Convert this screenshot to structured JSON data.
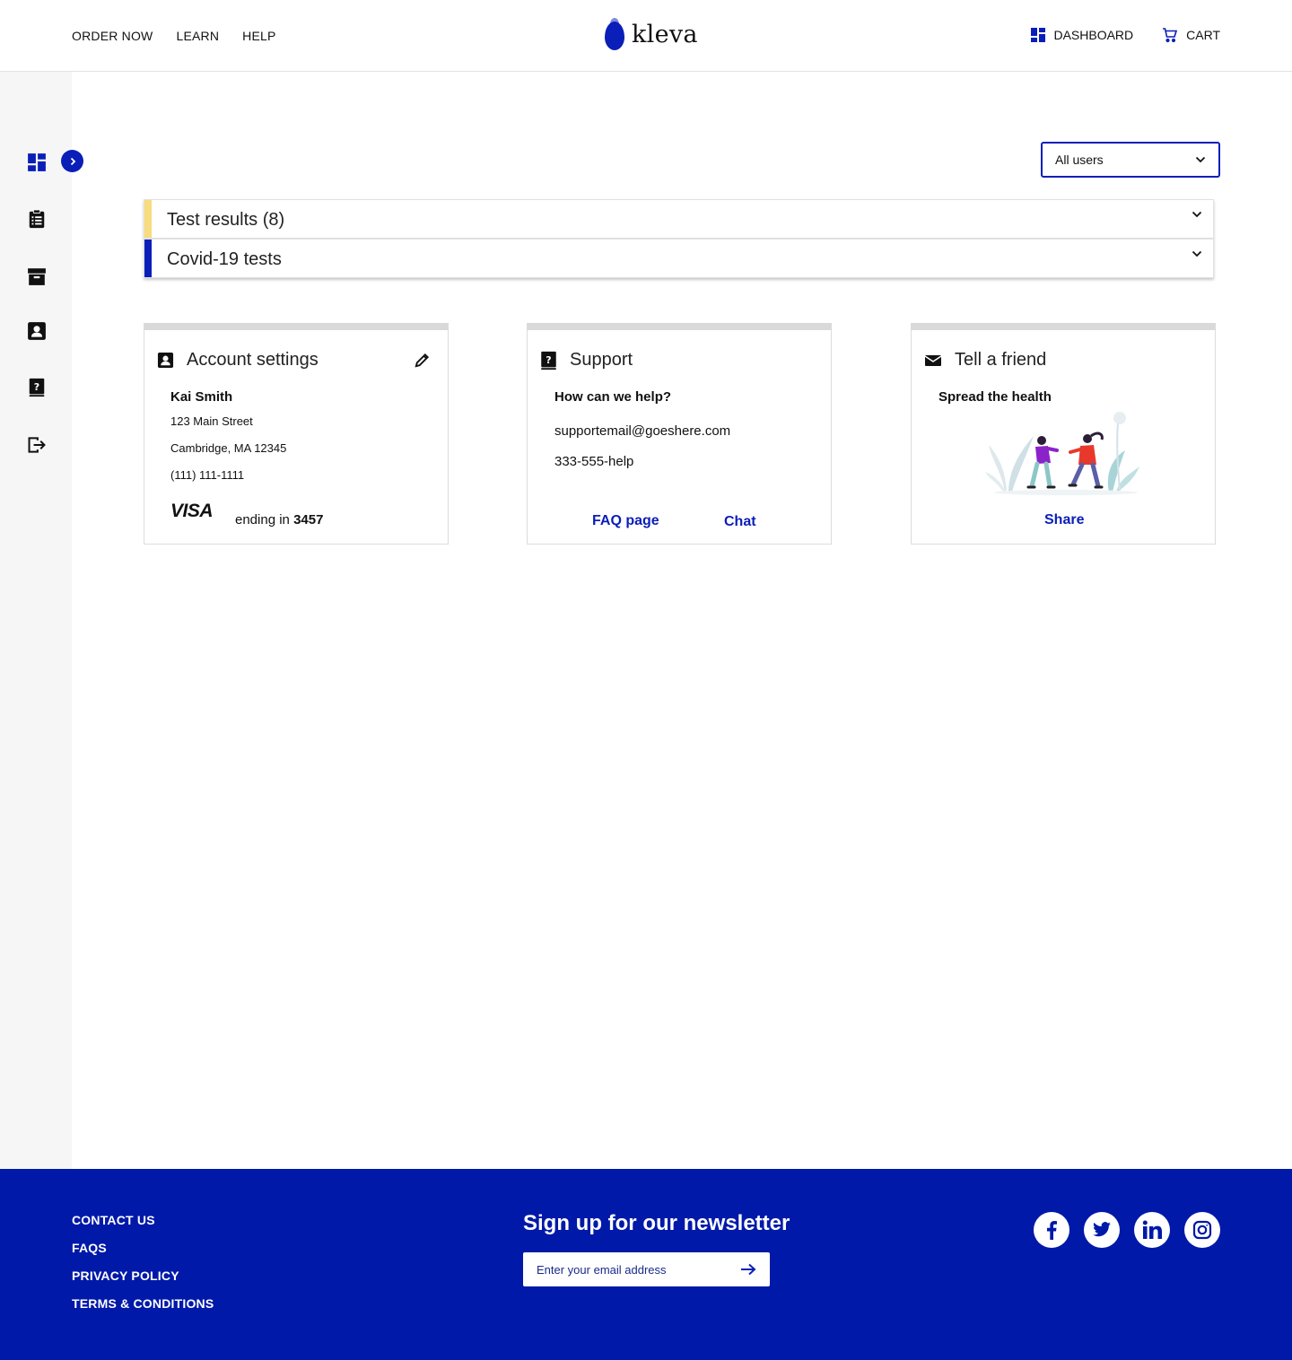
{
  "header": {
    "nav": [
      "ORDER NOW",
      "LEARN",
      "HELP"
    ],
    "logo_text": "kleva",
    "dashboard_label": "DASHBOARD",
    "cart_label": "CART"
  },
  "sidebar": {
    "icons": [
      "dashboard-icon",
      "clipboard-list-icon",
      "box-icon",
      "contact-card-icon",
      "help-book-icon",
      "logout-icon"
    ],
    "expand_icon": "chevron-right-icon"
  },
  "user_filter": {
    "selected": "All users"
  },
  "accordions": [
    {
      "label": "Test results (8)",
      "accent": "#f8dc7d"
    },
    {
      "label": "Covid-19 tests",
      "accent": "#0a1eb8"
    }
  ],
  "account_card": {
    "title": "Account settings",
    "name": "Kai Smith",
    "address_line1": "123 Main Street",
    "address_line2": "Cambridge, MA 12345",
    "phone": "(111) 111-1111",
    "card_brand": "VISA",
    "card_text": "ending in",
    "card_last4": "3457"
  },
  "support_card": {
    "title": "Support",
    "subtitle": "How can we help?",
    "email": "supportemail@goeshere.com",
    "phone": "333-555-help",
    "faq_link": "FAQ page",
    "chat_link": "Chat"
  },
  "friend_card": {
    "title": "Tell a friend",
    "subtitle": "Spread the health",
    "share_link": "Share"
  },
  "footer": {
    "links": [
      "CONTACT US",
      "FAQS",
      "PRIVACY POLICY",
      "TERMS & CONDITIONS"
    ],
    "newsletter_title": "Sign up for our newsletter",
    "newsletter_placeholder": "Enter your email address",
    "socials": [
      "facebook-icon",
      "twitter-icon",
      "linkedin-icon",
      "instagram-icon"
    ]
  },
  "colors": {
    "brand": "#0a1eb8",
    "footer_bg": "#0019a8",
    "test_results_accent": "#f8dc7d"
  }
}
